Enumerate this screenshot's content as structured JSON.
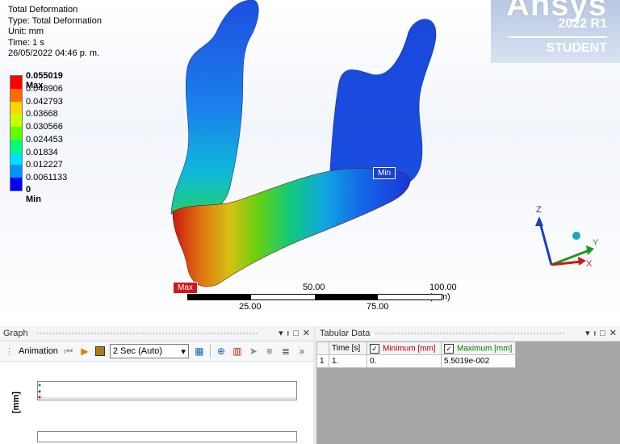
{
  "viewport": {
    "info": {
      "title": "Total Deformation",
      "type": "Type: Total Deformation",
      "unit": "Unit: mm",
      "time": "Time: 1 s",
      "date": "26/05/2022 04:46 p. m."
    },
    "legend": {
      "max_label": "0.055019 Max",
      "values": [
        "0.048906",
        "0.042793",
        "0.03668",
        "0.030566",
        "0.024453",
        "0.01834",
        "0.012227",
        "0.0061133"
      ],
      "min_label": "0 Min",
      "colors": [
        "#ff0000",
        "#ff6a00",
        "#ffd500",
        "#c8ff00",
        "#5fff00",
        "#00ff76",
        "#00e0ff",
        "#0095ff",
        "#0000ff"
      ]
    },
    "brand": {
      "logo": "Ansys",
      "release": "2022 R1",
      "edition": "STUDENT"
    },
    "probes": {
      "min": "Min",
      "max": "Max"
    },
    "scale": {
      "top_mid": "50.00",
      "top_right": "100.00 (mm)",
      "bottom_left": "25.00",
      "bottom_right": "75.00"
    },
    "triad": {
      "z": "Z",
      "y": "Y",
      "x": "X"
    }
  },
  "graph_panel": {
    "title": "Graph",
    "animation_label": "Animation",
    "speed_select": "2 Sec (Auto)",
    "y_axis_unit": "[mm]",
    "controls": [
      "▾",
      "ᵼ",
      "□",
      "✕"
    ]
  },
  "tabular_panel": {
    "title": "Tabular Data",
    "columns": [
      "Time [s]",
      "Minimum [mm]",
      "Maximum [mm]"
    ],
    "rows": [
      {
        "index": "1",
        "time": "1.",
        "minimum": "0.",
        "maximum": "5.5019e-002"
      }
    ],
    "min_color": "#c00000",
    "max_color": "#008000"
  }
}
